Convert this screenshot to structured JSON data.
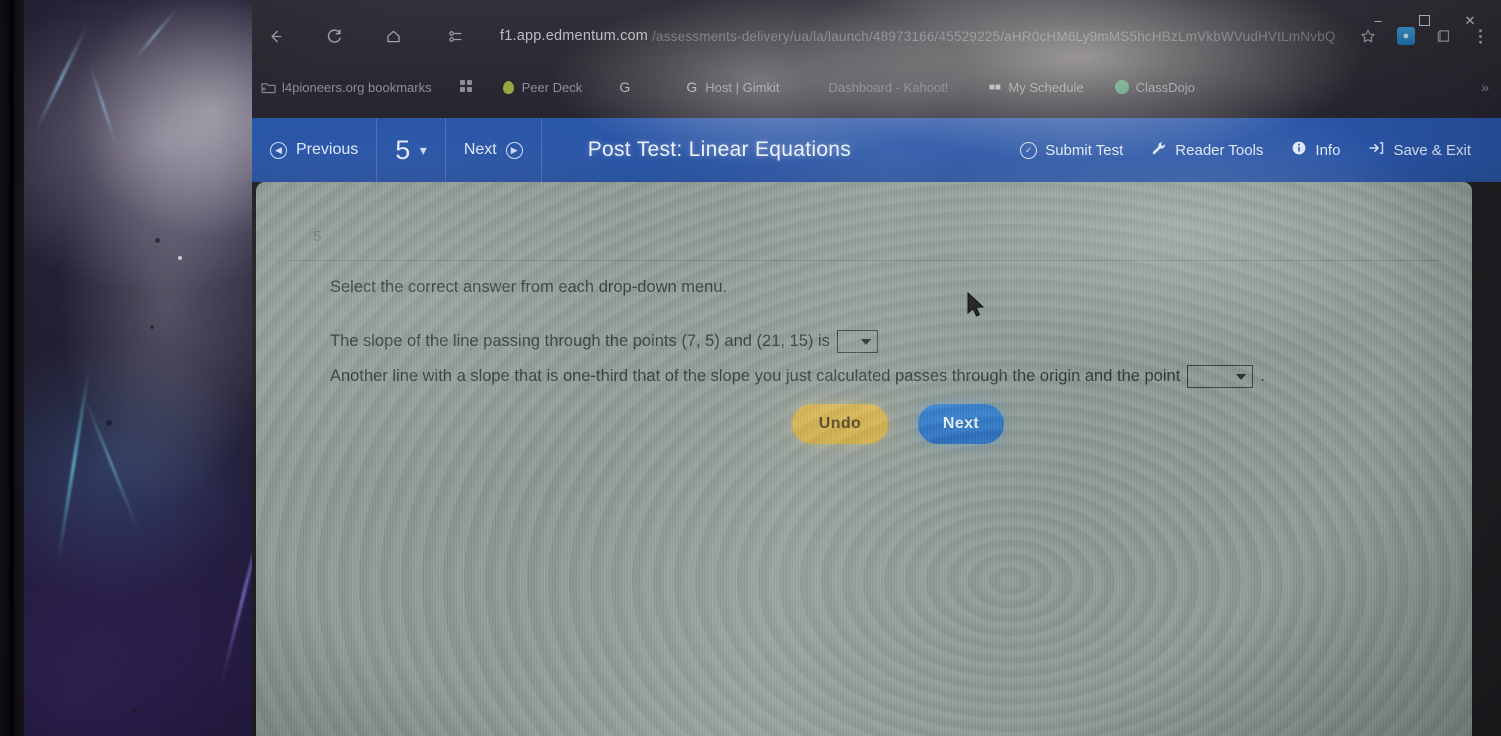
{
  "window": {
    "minimize_label": "–",
    "maximize_label": "☐",
    "close_label": "✕"
  },
  "browser": {
    "back_icon": "back-arrow-icon",
    "reload_icon": "reload-icon",
    "home_icon": "home-icon",
    "split_icon": "split-screen-icon",
    "url": "f1.app.edmentum.com",
    "url_path": "/assessments-delivery/ua/la/launch/48973166/45529225/aHR0cHM6Ly9mMS5hcHBzLmVkbWVudHVtLmNvbQ",
    "star_icon": "bookmark-star-icon",
    "profile_icon": "profile-avatar-icon",
    "collections_icon": "collections-icon",
    "menu_icon": "three-dot-menu-icon",
    "bookmarks": [
      {
        "label": "l4pioneers.org bookmarks",
        "icon": "folder-icon"
      },
      {
        "label": "",
        "icon": "apps-grid-icon"
      },
      {
        "label": "Peer Deck",
        "icon": "pear-deck-icon"
      },
      {
        "label": "",
        "icon": "google-g-icon"
      },
      {
        "label": "Host | Gimkit",
        "icon": "google-g-icon"
      },
      {
        "label": "Dashboard - Kahoot!",
        "icon": "kahoot-icon"
      },
      {
        "label": "My Schedule",
        "icon": "schedule-icon"
      },
      {
        "label": "ClassDojo",
        "icon": "classdojo-icon"
      }
    ],
    "bookmarks_overflow": "»"
  },
  "app_header": {
    "previous_label": "Previous",
    "previous_icon": "circle-left-arrow-icon",
    "question_number": "5",
    "question_dropdown_icon": "chevron-down-icon",
    "next_label": "Next",
    "next_icon": "circle-right-arrow-icon",
    "title": "Post Test: Linear Equations",
    "tools": [
      {
        "label": "Submit Test",
        "icon": "check-circle-icon"
      },
      {
        "label": "Reader Tools",
        "icon": "wrench-icon"
      },
      {
        "label": "Info",
        "icon": "info-circle-icon"
      },
      {
        "label": "Save & Exit",
        "icon": "exit-arrow-icon"
      }
    ]
  },
  "question": {
    "number": "5",
    "instruction": "Select the correct answer from each drop-down menu.",
    "line1_before": "The slope of the line passing through the points (7, 5) and (21, 15) is",
    "line1_after": "",
    "dropdown1_value": "",
    "line2_before": "Another line with a slope that is one-third that of the slope you just calculated passes through the origin and the point",
    "line2_after": ".",
    "dropdown2_value": ""
  },
  "actions": {
    "undo_label": "Undo",
    "next_label": "Next"
  },
  "colors": {
    "header_blue": "#2a56a8",
    "next_button_blue": "#2f7fd0",
    "undo_button_gold": "#d9b44a",
    "content_panel": "#8d9a93"
  }
}
